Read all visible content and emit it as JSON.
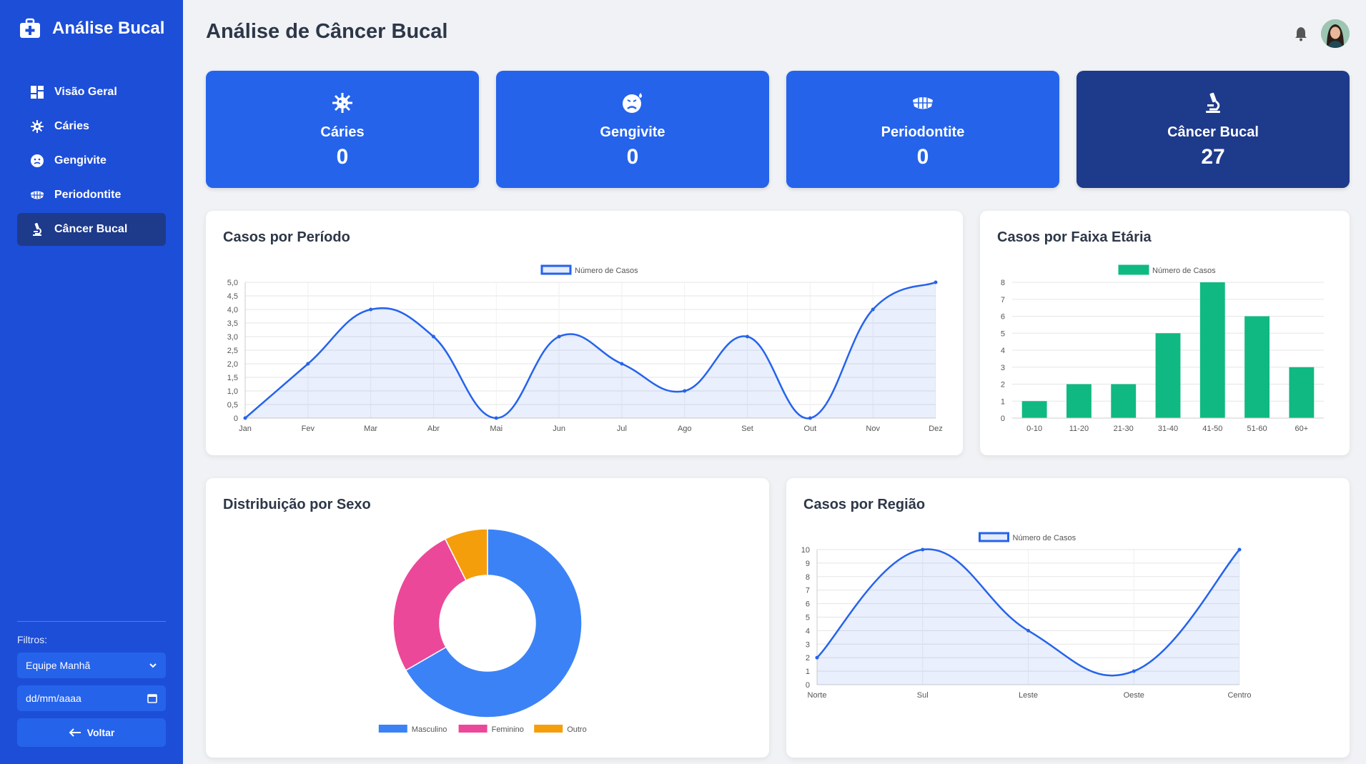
{
  "sidebar": {
    "brand_title": "Análise Bucal",
    "items": [
      {
        "label": "Visão Geral",
        "icon": "dashboard-icon"
      },
      {
        "label": "Cáries",
        "icon": "virus-icon"
      },
      {
        "label": "Gengivite",
        "icon": "sad-tooth-icon"
      },
      {
        "label": "Periodontite",
        "icon": "teeth-icon"
      },
      {
        "label": "Câncer Bucal",
        "icon": "microscope-icon",
        "active": true
      }
    ],
    "filters_label": "Filtros:",
    "team_select": "Equipe Manhã",
    "date_placeholder": "dd/mm/aaaa",
    "back_label": "Voltar"
  },
  "header": {
    "title": "Análise de Câncer Bucal"
  },
  "stats": [
    {
      "label": "Cáries",
      "value": "0",
      "icon": "virus-icon"
    },
    {
      "label": "Gengivite",
      "value": "0",
      "icon": "sad-face-icon"
    },
    {
      "label": "Periodontite",
      "value": "0",
      "icon": "teeth-icon"
    },
    {
      "label": "Câncer Bucal",
      "value": "27",
      "icon": "microscope-icon"
    }
  ],
  "panels": {
    "periodo_title": "Casos por Período",
    "faixa_title": "Casos por Faixa Etária",
    "sexo_title": "Distribuição por Sexo",
    "regiao_title": "Casos por Região"
  },
  "colors": {
    "sidebar": "#1d4ed8",
    "accent": "#2563eb",
    "active": "#1e3a8a",
    "line": "#2563eb",
    "bar": "#10b981",
    "male": "#3b82f6",
    "female": "#ec4899",
    "other": "#f59e0b"
  },
  "chart_data": [
    {
      "id": "periodo",
      "type": "line",
      "categories": [
        "Jan",
        "Fev",
        "Mar",
        "Abr",
        "Mai",
        "Jun",
        "Jul",
        "Ago",
        "Set",
        "Out",
        "Nov",
        "Dez"
      ],
      "series": [
        {
          "name": "Número de Casos",
          "values": [
            0,
            2,
            4,
            3,
            0,
            3,
            2,
            1,
            3,
            0,
            4,
            5
          ]
        }
      ],
      "y_ticks": [
        "0",
        "0,5",
        "1,0",
        "1,5",
        "2,0",
        "2,5",
        "3,0",
        "3,5",
        "4,0",
        "4,5",
        "5,0"
      ],
      "ylim": [
        0,
        5
      ],
      "legend": "top",
      "grid": true
    },
    {
      "id": "faixa",
      "type": "bar",
      "categories": [
        "0-10",
        "11-20",
        "21-30",
        "31-40",
        "41-50",
        "51-60",
        "60+"
      ],
      "series": [
        {
          "name": "Número de Casos",
          "values": [
            1,
            2,
            2,
            5,
            8,
            6,
            3
          ]
        }
      ],
      "y_ticks": [
        "0",
        "1",
        "2",
        "3",
        "4",
        "5",
        "6",
        "7",
        "8"
      ],
      "ylim": [
        0,
        8
      ],
      "legend": "top",
      "grid": true
    },
    {
      "id": "sexo",
      "type": "pie",
      "categories": [
        "Masculino",
        "Feminino",
        "Outro"
      ],
      "values": [
        18,
        7,
        2
      ],
      "legend": "bottom"
    },
    {
      "id": "regiao",
      "type": "line",
      "categories": [
        "Norte",
        "Sul",
        "Leste",
        "Oeste",
        "Centro"
      ],
      "series": [
        {
          "name": "Número de Casos",
          "values": [
            2,
            10,
            4,
            1,
            10
          ]
        }
      ],
      "y_ticks": [
        "0",
        "1",
        "2",
        "3",
        "4",
        "5",
        "6",
        "7",
        "8",
        "9",
        "10"
      ],
      "ylim": [
        0,
        10
      ],
      "legend": "top",
      "grid": true
    }
  ]
}
